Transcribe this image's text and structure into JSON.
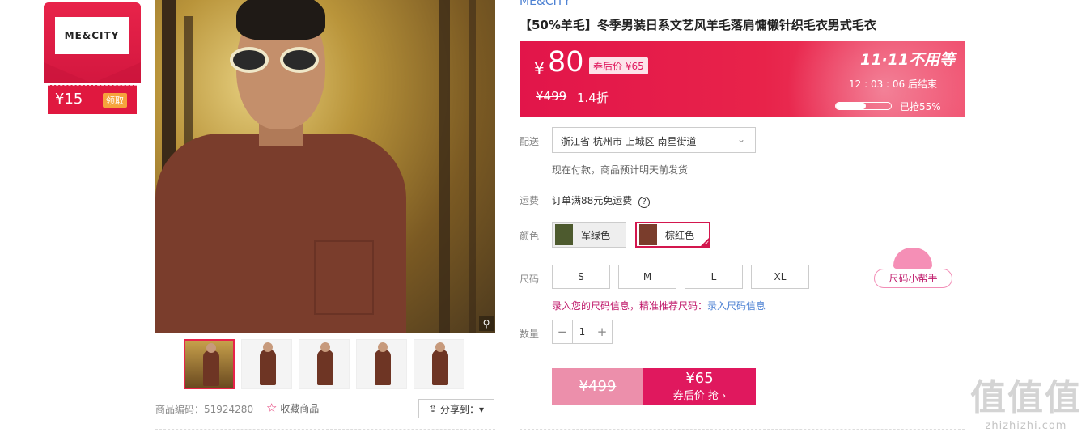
{
  "coupon": {
    "brand_logo": "ME&CITY",
    "amount": "¥15",
    "claim_label": "领取"
  },
  "gallery": {
    "thumb_count": 5,
    "sku_code": "商品编码：51924280",
    "favorite_label": "收藏商品",
    "share_label": "分享到：▾"
  },
  "product": {
    "brand": "ME&CITY",
    "title": "【50%羊毛】冬季男装日系文艺风羊毛落肩慵懒针织毛衣男式毛衣"
  },
  "price": {
    "yen": "¥",
    "current": "80",
    "coupon_tag": "券后价 ¥65",
    "original": "¥499",
    "discount": "1.4折",
    "campaign": "11·11不用等",
    "timer": "12 : 03 : 06  后结束",
    "grabbed_text": "已抢55%",
    "grabbed_fraction": 0.55,
    "accent_color": "#e8234a"
  },
  "delivery": {
    "label": "配送",
    "address": "浙江省 杭州市 上城区 南星街道",
    "note": "现在付款，商品预计明天前发货"
  },
  "freight": {
    "label": "运费",
    "text": "订单满88元免运费",
    "help_icon": "?"
  },
  "color": {
    "label": "颜色",
    "options": [
      {
        "name": "军绿色",
        "swatch": "#4d5a2e",
        "selected": false
      },
      {
        "name": "棕红色",
        "swatch": "#7a3d2c",
        "selected": true
      }
    ]
  },
  "size": {
    "label": "尺码",
    "options": [
      "S",
      "M",
      "L",
      "XL"
    ],
    "tip_prefix": "录入您的尺码信息，精准推荐尺码：",
    "tip_link": "录入尺码信息",
    "helper": "尺码小帮手"
  },
  "quantity": {
    "label": "数量",
    "minus": "−",
    "value": "1",
    "plus": "+"
  },
  "buy": {
    "original": "¥499",
    "price": "¥65",
    "action": "券后价 抢 ›"
  },
  "watermark": {
    "big": "值值值",
    "small": "zhizhizhi.com"
  }
}
